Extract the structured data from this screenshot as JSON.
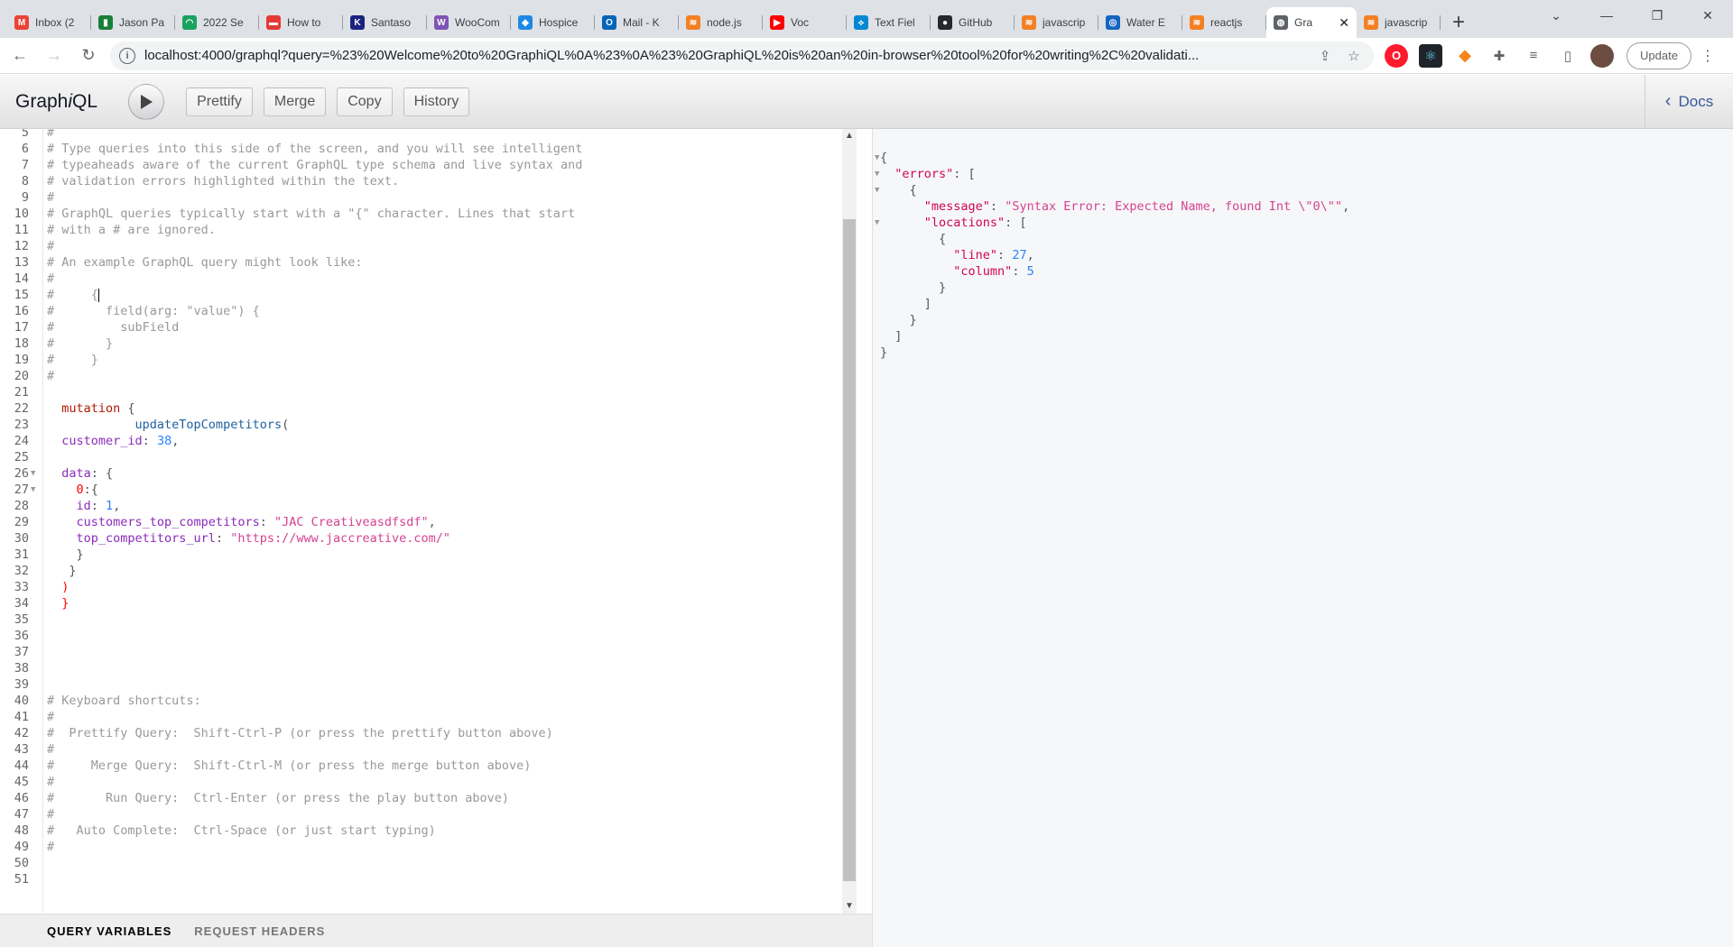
{
  "browser": {
    "tabs": [
      {
        "title": "Inbox (2",
        "color": "#ea4335",
        "glyph": "M",
        "active": false
      },
      {
        "title": "Jason Pa",
        "color": "#188038",
        "glyph": "▮",
        "active": false
      },
      {
        "title": "2022 Se",
        "color": "#1aa260",
        "glyph": "◠",
        "active": false
      },
      {
        "title": "How to",
        "color": "#e53935",
        "glyph": "▬",
        "active": false
      },
      {
        "title": "Santaso",
        "color": "#1a237e",
        "glyph": "K",
        "active": false
      },
      {
        "title": "WooCom",
        "color": "#7f54b3",
        "glyph": "W",
        "active": false
      },
      {
        "title": "Hospice",
        "color": "#1e88e5",
        "glyph": "◆",
        "active": false
      },
      {
        "title": "Mail - K",
        "color": "#0364b8",
        "glyph": "O",
        "active": false
      },
      {
        "title": "node.js",
        "color": "#f48024",
        "glyph": "≋",
        "active": false
      },
      {
        "title": "Voc",
        "color": "#ff0000",
        "glyph": "▶",
        "active": false
      },
      {
        "title": "Text Fiel",
        "color": "#0288d1",
        "glyph": "⟡",
        "active": false
      },
      {
        "title": "GitHub",
        "color": "#24292e",
        "glyph": "●",
        "active": false
      },
      {
        "title": "javascrip",
        "color": "#f48024",
        "glyph": "≋",
        "active": false
      },
      {
        "title": "Water E",
        "color": "#1565c0",
        "glyph": "◎",
        "active": false
      },
      {
        "title": "reactjs",
        "color": "#f48024",
        "glyph": "≋",
        "active": false
      },
      {
        "title": "Gra",
        "color": "#5f6368",
        "glyph": "◍",
        "active": true
      },
      {
        "title": "javascrip",
        "color": "#f48024",
        "glyph": "≋",
        "active": false
      }
    ],
    "url": "localhost:4000/graphql?query=%23%20Welcome%20to%20GraphiQL%0A%23%0A%23%20GraphiQL%20is%20an%20in-browser%20tool%20for%20writing%2C%20validati...",
    "update_label": "Update"
  },
  "graphiql": {
    "title_prefix": "Graph",
    "title_italic": "i",
    "title_suffix": "QL",
    "buttons": {
      "prettify": "Prettify",
      "merge": "Merge",
      "copy": "Copy",
      "history": "History"
    },
    "docs_label": "Docs",
    "variables_tab": "QUERY VARIABLES",
    "headers_tab": "REQUEST HEADERS"
  },
  "editor_lines": [
    {
      "n": "5",
      "t": [
        [
          "c-comment",
          "#"
        ]
      ]
    },
    {
      "n": "6",
      "t": [
        [
          "c-comment",
          "# Type queries into this side of the screen, and you will see intelligent"
        ]
      ]
    },
    {
      "n": "7",
      "t": [
        [
          "c-comment",
          "# typeaheads aware of the current GraphQL type schema and live syntax and"
        ]
      ]
    },
    {
      "n": "8",
      "t": [
        [
          "c-comment",
          "# validation errors highlighted within the text."
        ]
      ]
    },
    {
      "n": "9",
      "t": [
        [
          "c-comment",
          "#"
        ]
      ]
    },
    {
      "n": "10",
      "t": [
        [
          "c-comment",
          "# GraphQL queries typically start with a \"{\" character. Lines that start"
        ]
      ]
    },
    {
      "n": "11",
      "t": [
        [
          "c-comment",
          "# with a # are ignored."
        ]
      ]
    },
    {
      "n": "12",
      "t": [
        [
          "c-comment",
          "#"
        ]
      ]
    },
    {
      "n": "13",
      "t": [
        [
          "c-comment",
          "# An example GraphQL query might look like:"
        ]
      ]
    },
    {
      "n": "14",
      "t": [
        [
          "c-comment",
          "#"
        ]
      ]
    },
    {
      "n": "15",
      "t": [
        [
          "c-comment",
          "#     {"
        ]
      ],
      "cursor": true
    },
    {
      "n": "16",
      "t": [
        [
          "c-comment",
          "#       field(arg: \"value\") {"
        ]
      ]
    },
    {
      "n": "17",
      "t": [
        [
          "c-comment",
          "#         subField"
        ]
      ]
    },
    {
      "n": "18",
      "t": [
        [
          "c-comment",
          "#       }"
        ]
      ]
    },
    {
      "n": "19",
      "t": [
        [
          "c-comment",
          "#     }"
        ]
      ]
    },
    {
      "n": "20",
      "t": [
        [
          "c-comment",
          "#"
        ]
      ]
    },
    {
      "n": "21",
      "t": []
    },
    {
      "n": "22",
      "t": [
        [
          "c-keyword",
          "  mutation"
        ],
        [
          "c-punct",
          " {"
        ]
      ]
    },
    {
      "n": "23",
      "t": [
        [
          "c-prop",
          "            updateTopCompetitors"
        ],
        [
          "c-punct",
          "("
        ]
      ]
    },
    {
      "n": "24",
      "t": [
        [
          "c-attr",
          "  customer_id"
        ],
        [
          "c-punct",
          ": "
        ],
        [
          "c-num",
          "38"
        ],
        [
          "c-punct",
          ","
        ]
      ]
    },
    {
      "n": "25",
      "t": []
    },
    {
      "n": "26",
      "t": [
        [
          "c-attr",
          "  data"
        ],
        [
          "c-punct",
          ": {"
        ]
      ],
      "fold": true
    },
    {
      "n": "27",
      "t": [
        [
          "c-err",
          "    0"
        ],
        [
          "c-punct",
          ":{"
        ]
      ],
      "fold": true
    },
    {
      "n": "28",
      "t": [
        [
          "c-attr",
          "    id"
        ],
        [
          "c-punct",
          ": "
        ],
        [
          "c-num",
          "1"
        ],
        [
          "c-punct",
          ","
        ]
      ]
    },
    {
      "n": "29",
      "t": [
        [
          "c-attr",
          "    customers_top_competitors"
        ],
        [
          "c-punct",
          ": "
        ],
        [
          "c-str",
          "\"JAC Creativeasdfsdf\""
        ],
        [
          "c-punct",
          ","
        ]
      ]
    },
    {
      "n": "30",
      "t": [
        [
          "c-attr",
          "    top_competitors_url"
        ],
        [
          "c-punct",
          ": "
        ],
        [
          "c-str",
          "\"https://www.jaccreative.com/\""
        ]
      ]
    },
    {
      "n": "31",
      "t": [
        [
          "c-punct",
          "    }"
        ]
      ]
    },
    {
      "n": "32",
      "t": [
        [
          "c-punct",
          "   }"
        ]
      ]
    },
    {
      "n": "33",
      "t": [
        [
          "c-err",
          "  )"
        ]
      ]
    },
    {
      "n": "34",
      "t": [
        [
          "c-err",
          "  }"
        ]
      ]
    },
    {
      "n": "35",
      "t": []
    },
    {
      "n": "36",
      "t": []
    },
    {
      "n": "37",
      "t": []
    },
    {
      "n": "38",
      "t": []
    },
    {
      "n": "39",
      "t": []
    },
    {
      "n": "40",
      "t": [
        [
          "c-comment",
          "# Keyboard shortcuts:"
        ]
      ]
    },
    {
      "n": "41",
      "t": [
        [
          "c-comment",
          "#"
        ]
      ]
    },
    {
      "n": "42",
      "t": [
        [
          "c-comment",
          "#  Prettify Query:  Shift-Ctrl-P (or press the prettify button above)"
        ]
      ]
    },
    {
      "n": "43",
      "t": [
        [
          "c-comment",
          "#"
        ]
      ]
    },
    {
      "n": "44",
      "t": [
        [
          "c-comment",
          "#     Merge Query:  Shift-Ctrl-M (or press the merge button above)"
        ]
      ]
    },
    {
      "n": "45",
      "t": [
        [
          "c-comment",
          "#"
        ]
      ]
    },
    {
      "n": "46",
      "t": [
        [
          "c-comment",
          "#       Run Query:  Ctrl-Enter (or press the play button above)"
        ]
      ]
    },
    {
      "n": "47",
      "t": [
        [
          "c-comment",
          "#"
        ]
      ]
    },
    {
      "n": "48",
      "t": [
        [
          "c-comment",
          "#   Auto Complete:  Ctrl-Space (or just start typing)"
        ]
      ]
    },
    {
      "n": "49",
      "t": [
        [
          "c-comment",
          "#"
        ]
      ]
    },
    {
      "n": "50",
      "t": []
    },
    {
      "n": "51",
      "t": []
    }
  ],
  "result_lines": [
    {
      "fold": true,
      "t": [
        [
          "c-punct",
          "{"
        ]
      ]
    },
    {
      "fold": true,
      "t": [
        [
          "c-def",
          "  \"errors\""
        ],
        [
          "c-punct",
          ": ["
        ]
      ]
    },
    {
      "fold": true,
      "t": [
        [
          "c-punct",
          "    {"
        ]
      ]
    },
    {
      "fold": false,
      "t": [
        [
          "c-def",
          "      \"message\""
        ],
        [
          "c-punct",
          ": "
        ],
        [
          "c-str",
          "\"Syntax Error: Expected Name, found Int \\\"0\\\"\""
        ],
        [
          "c-punct",
          ","
        ]
      ]
    },
    {
      "fold": true,
      "t": [
        [
          "c-def",
          "      \"locations\""
        ],
        [
          "c-punct",
          ": ["
        ]
      ]
    },
    {
      "fold": false,
      "t": [
        [
          "c-punct",
          "        {"
        ]
      ]
    },
    {
      "fold": false,
      "t": [
        [
          "c-def",
          "          \"line\""
        ],
        [
          "c-punct",
          ": "
        ],
        [
          "c-num",
          "27"
        ],
        [
          "c-punct",
          ","
        ]
      ]
    },
    {
      "fold": false,
      "t": [
        [
          "c-def",
          "          \"column\""
        ],
        [
          "c-punct",
          ": "
        ],
        [
          "c-num",
          "5"
        ]
      ]
    },
    {
      "fold": false,
      "t": [
        [
          "c-punct",
          "        }"
        ]
      ]
    },
    {
      "fold": false,
      "t": [
        [
          "c-punct",
          "      ]"
        ]
      ]
    },
    {
      "fold": false,
      "t": [
        [
          "c-punct",
          "    }"
        ]
      ]
    },
    {
      "fold": false,
      "t": [
        [
          "c-punct",
          "  ]"
        ]
      ]
    },
    {
      "fold": false,
      "t": [
        [
          "c-punct",
          "}"
        ]
      ]
    }
  ]
}
